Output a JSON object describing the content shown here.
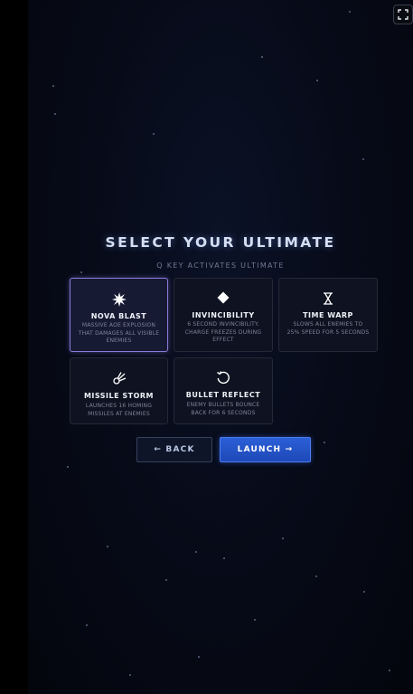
{
  "screen": {
    "title": "SELECT YOUR ULTIMATE",
    "subtitle": "Q KEY ACTIVATES ULTIMATE"
  },
  "ultimates": [
    {
      "name": "NOVA BLAST",
      "desc": "MASSIVE AOE EXPLOSION THAT DAMAGES ALL VISIBLE ENEMIES",
      "icon": "starburst-icon",
      "selected": true
    },
    {
      "name": "INVINCIBILITY",
      "desc": "6 SECOND INVINCIBILITY. CHARGE FREEZES DURING EFFECT",
      "icon": "diamond-icon",
      "selected": false
    },
    {
      "name": "TIME WARP",
      "desc": "SLOWS ALL ENEMIES TO 25% SPEED FOR 5 SECONDS",
      "icon": "hourglass-icon",
      "selected": false
    },
    {
      "name": "MISSILE STORM",
      "desc": "LAUNCHES 16 HOMING MISSILES AT ENEMIES",
      "icon": "comet-icon",
      "selected": false
    },
    {
      "name": "BULLET REFLECT",
      "desc": "ENEMY BULLETS BOUNCE BACK FOR 6 SECONDS",
      "icon": "reflect-arrow-icon",
      "selected": false
    }
  ],
  "buttons": {
    "back": "← BACK",
    "launch": "LAUNCH →"
  },
  "colors": {
    "selected_border": "#8a7bd8",
    "launch_button": "#2456c8",
    "background": "#05070f"
  }
}
